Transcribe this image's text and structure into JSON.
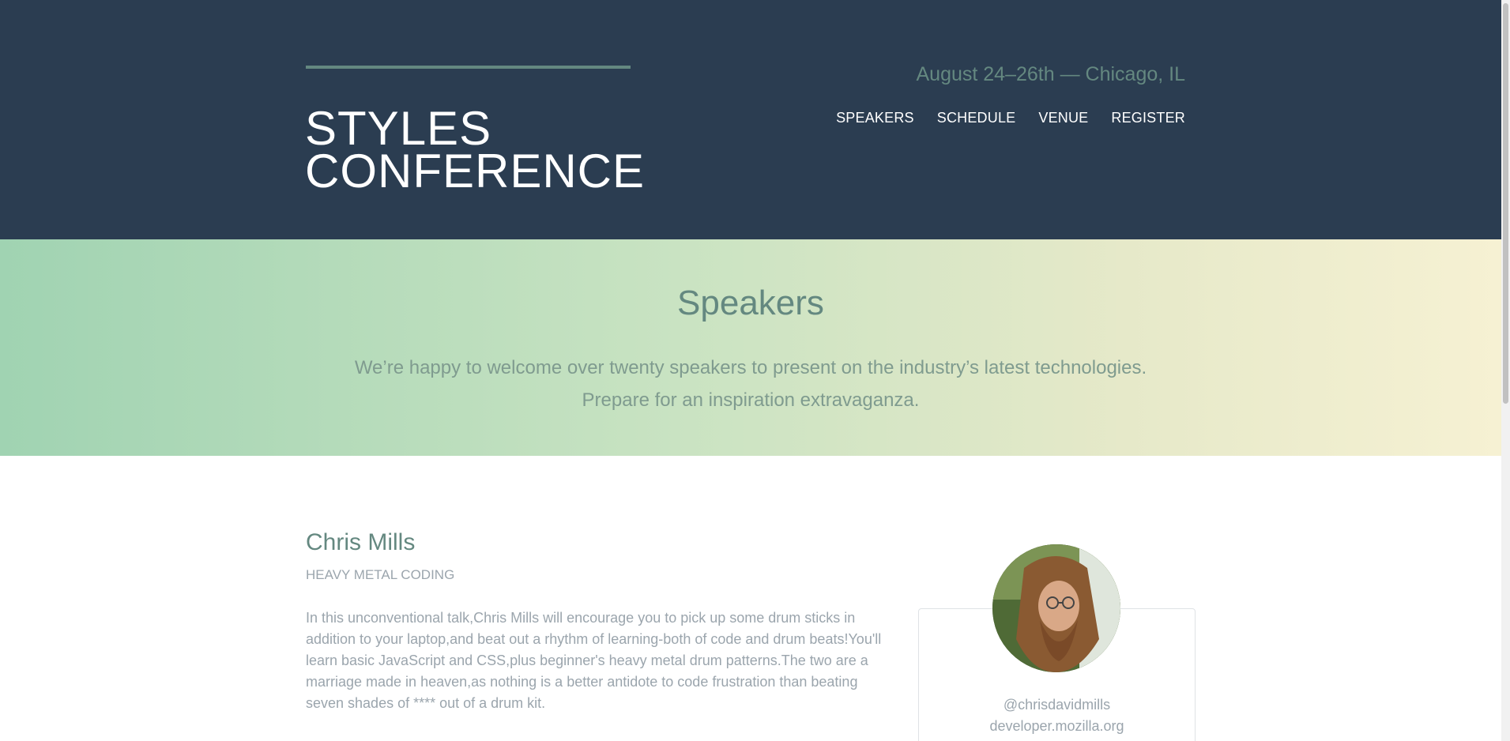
{
  "header": {
    "logo_line1": "STYLES",
    "logo_line2": "CONFERENCE",
    "tagline": "August 24–26th — Chicago, IL",
    "nav": [
      "SPEAKERS",
      "SCHEDULE",
      "VENUE",
      "REGISTER"
    ]
  },
  "hero": {
    "title": "Speakers",
    "line1": "We’re happy to welcome over twenty speakers to present on the industry’s latest technologies.",
    "line2": "Prepare for an inspiration extravaganza."
  },
  "speaker": {
    "name": "Chris Mills",
    "talk": "HEAVY METAL CODING",
    "bio": "In this unconventional talk,Chris Mills will encourage you to pick up some drum sticks in addition to your laptop,and beat out a rhythm of learning-both of code and drum beats!You'll learn basic JavaScript and CSS,plus beginner's heavy metal drum patterns.The two are a marriage made in heaven,as nothing is a better antidote to code frustration than beating seven shades of **** out of a drum kit.",
    "handle": "@chrisdavidmills",
    "site": "developer.mozilla.org"
  },
  "colors": {
    "header_bg": "#2b3d51",
    "accent": "#648880",
    "hero_gradient_start": "#a0d3b2",
    "hero_gradient_end": "#f6f1d3",
    "body_text": "#9ba5ad"
  }
}
